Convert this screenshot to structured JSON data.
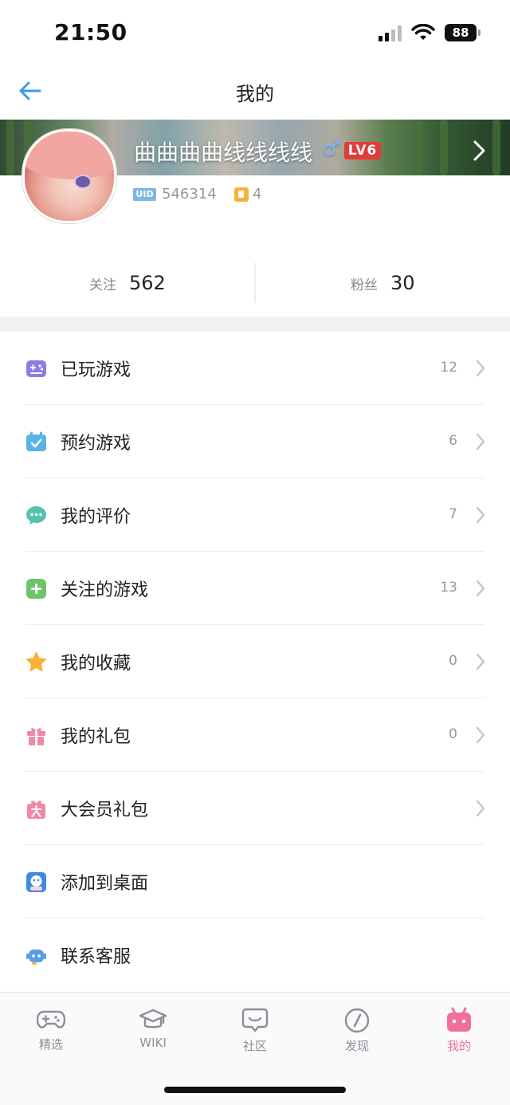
{
  "status_bar": {
    "time": "21:50",
    "battery": "88"
  },
  "nav": {
    "title": "我的"
  },
  "profile": {
    "username": "曲曲曲曲线线线线",
    "gender_symbol": "♂",
    "level": "LV6",
    "uid_label": "UID",
    "uid": "546314",
    "likes": "4"
  },
  "stats": {
    "following_label": "关注",
    "following_value": "562",
    "fans_label": "粉丝",
    "fans_value": "30"
  },
  "menu": {
    "items": [
      {
        "label": "已玩游戏",
        "count": "12",
        "icon": "gamepad-icon",
        "color": "#8c7be8"
      },
      {
        "label": "预约游戏",
        "count": "6",
        "icon": "calendar-check-icon",
        "color": "#5ab3e6"
      },
      {
        "label": "我的评价",
        "count": "7",
        "icon": "chat-bubble-icon",
        "color": "#55c2b0"
      },
      {
        "label": "关注的游戏",
        "count": "13",
        "icon": "plus-square-icon",
        "color": "#6dc46d"
      },
      {
        "label": "我的收藏",
        "count": "0",
        "icon": "star-icon",
        "color": "#f5b33b"
      },
      {
        "label": "我的礼包",
        "count": "0",
        "icon": "gift-icon",
        "color": "#f08aa4"
      },
      {
        "label": "大会员礼包",
        "count": "",
        "icon": "vip-gift-icon",
        "color": "#f08aa4"
      },
      {
        "label": "添加到桌面",
        "count": "",
        "icon": "app-shortcut-icon",
        "color": "#3d8ae6"
      },
      {
        "label": "联系客服",
        "count": "",
        "icon": "robot-icon",
        "color": "#5a9ee6"
      }
    ]
  },
  "tabbar": {
    "tabs": [
      {
        "label": "精选",
        "icon": "gamepad-tab-icon"
      },
      {
        "label": "WIKI",
        "icon": "graduation-cap-icon"
      },
      {
        "label": "社区",
        "icon": "smile-chat-icon"
      },
      {
        "label": "发现",
        "icon": "compass-icon"
      },
      {
        "label": "我的",
        "icon": "tv-face-icon",
        "active": true
      }
    ],
    "active_color": "#f0709a",
    "inactive_color": "#8a8f99"
  }
}
